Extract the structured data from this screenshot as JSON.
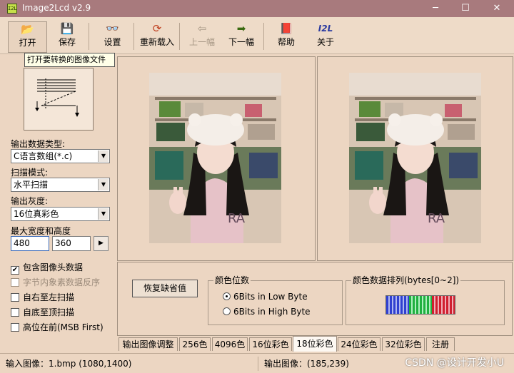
{
  "window": {
    "icon_text": "I2L",
    "title": "Image2Lcd v2.9",
    "minimize": "─",
    "maximize": "☐",
    "close": "✕"
  },
  "toolbar": {
    "open": "打开",
    "save": "保存",
    "settings": "设置",
    "reload": "重新载入",
    "prev": "上一幅",
    "next": "下一幅",
    "help": "帮助",
    "about": "关于",
    "about_glyph": "I2L"
  },
  "tooltip": "打开要转换的图像文件",
  "left": {
    "output_type_label": "输出数据类型:",
    "output_type_value": "C语言数组(*.c)",
    "scan_mode_label": "扫描模式:",
    "scan_mode_value": "水平扫描",
    "gray_label": "输出灰度:",
    "gray_value": "16位真彩色",
    "maxsize_label": "最大宽度和高度",
    "max_width": "480",
    "max_height": "360",
    "lock_button": "▶",
    "checks": {
      "include_header": "包含图像头数据",
      "byte_reverse": "字节内象素数据反序",
      "right_to_left": "自右至左扫描",
      "bottom_to_top": "自底至顶扫描",
      "msb_first": "高位在前(MSB First)"
    }
  },
  "bottom": {
    "restore_defaults": "恢复缺省值",
    "color_bits_title": "颜色位数",
    "radio_low": "6Bits in Low Byte",
    "radio_high": "6Bits in High Byte",
    "color_order_title": "颜色数据排列(bytes[0~2])",
    "selected_color_bits": "6Bits in Low Byte"
  },
  "tabs": [
    "输出图像调整",
    "256色",
    "4096色",
    "16位彩色",
    "18位彩色",
    "24位彩色",
    "32位彩色",
    "注册"
  ],
  "active_tab": "18位彩色",
  "status": {
    "input": "输入图像：1.bmp (1080,1400)",
    "output": "输出图像：(185,239)"
  },
  "watermark": "CSDN @设计开发小U",
  "colors": {
    "titlebar": "#a87a7d",
    "panel": "#ecd6c2"
  }
}
